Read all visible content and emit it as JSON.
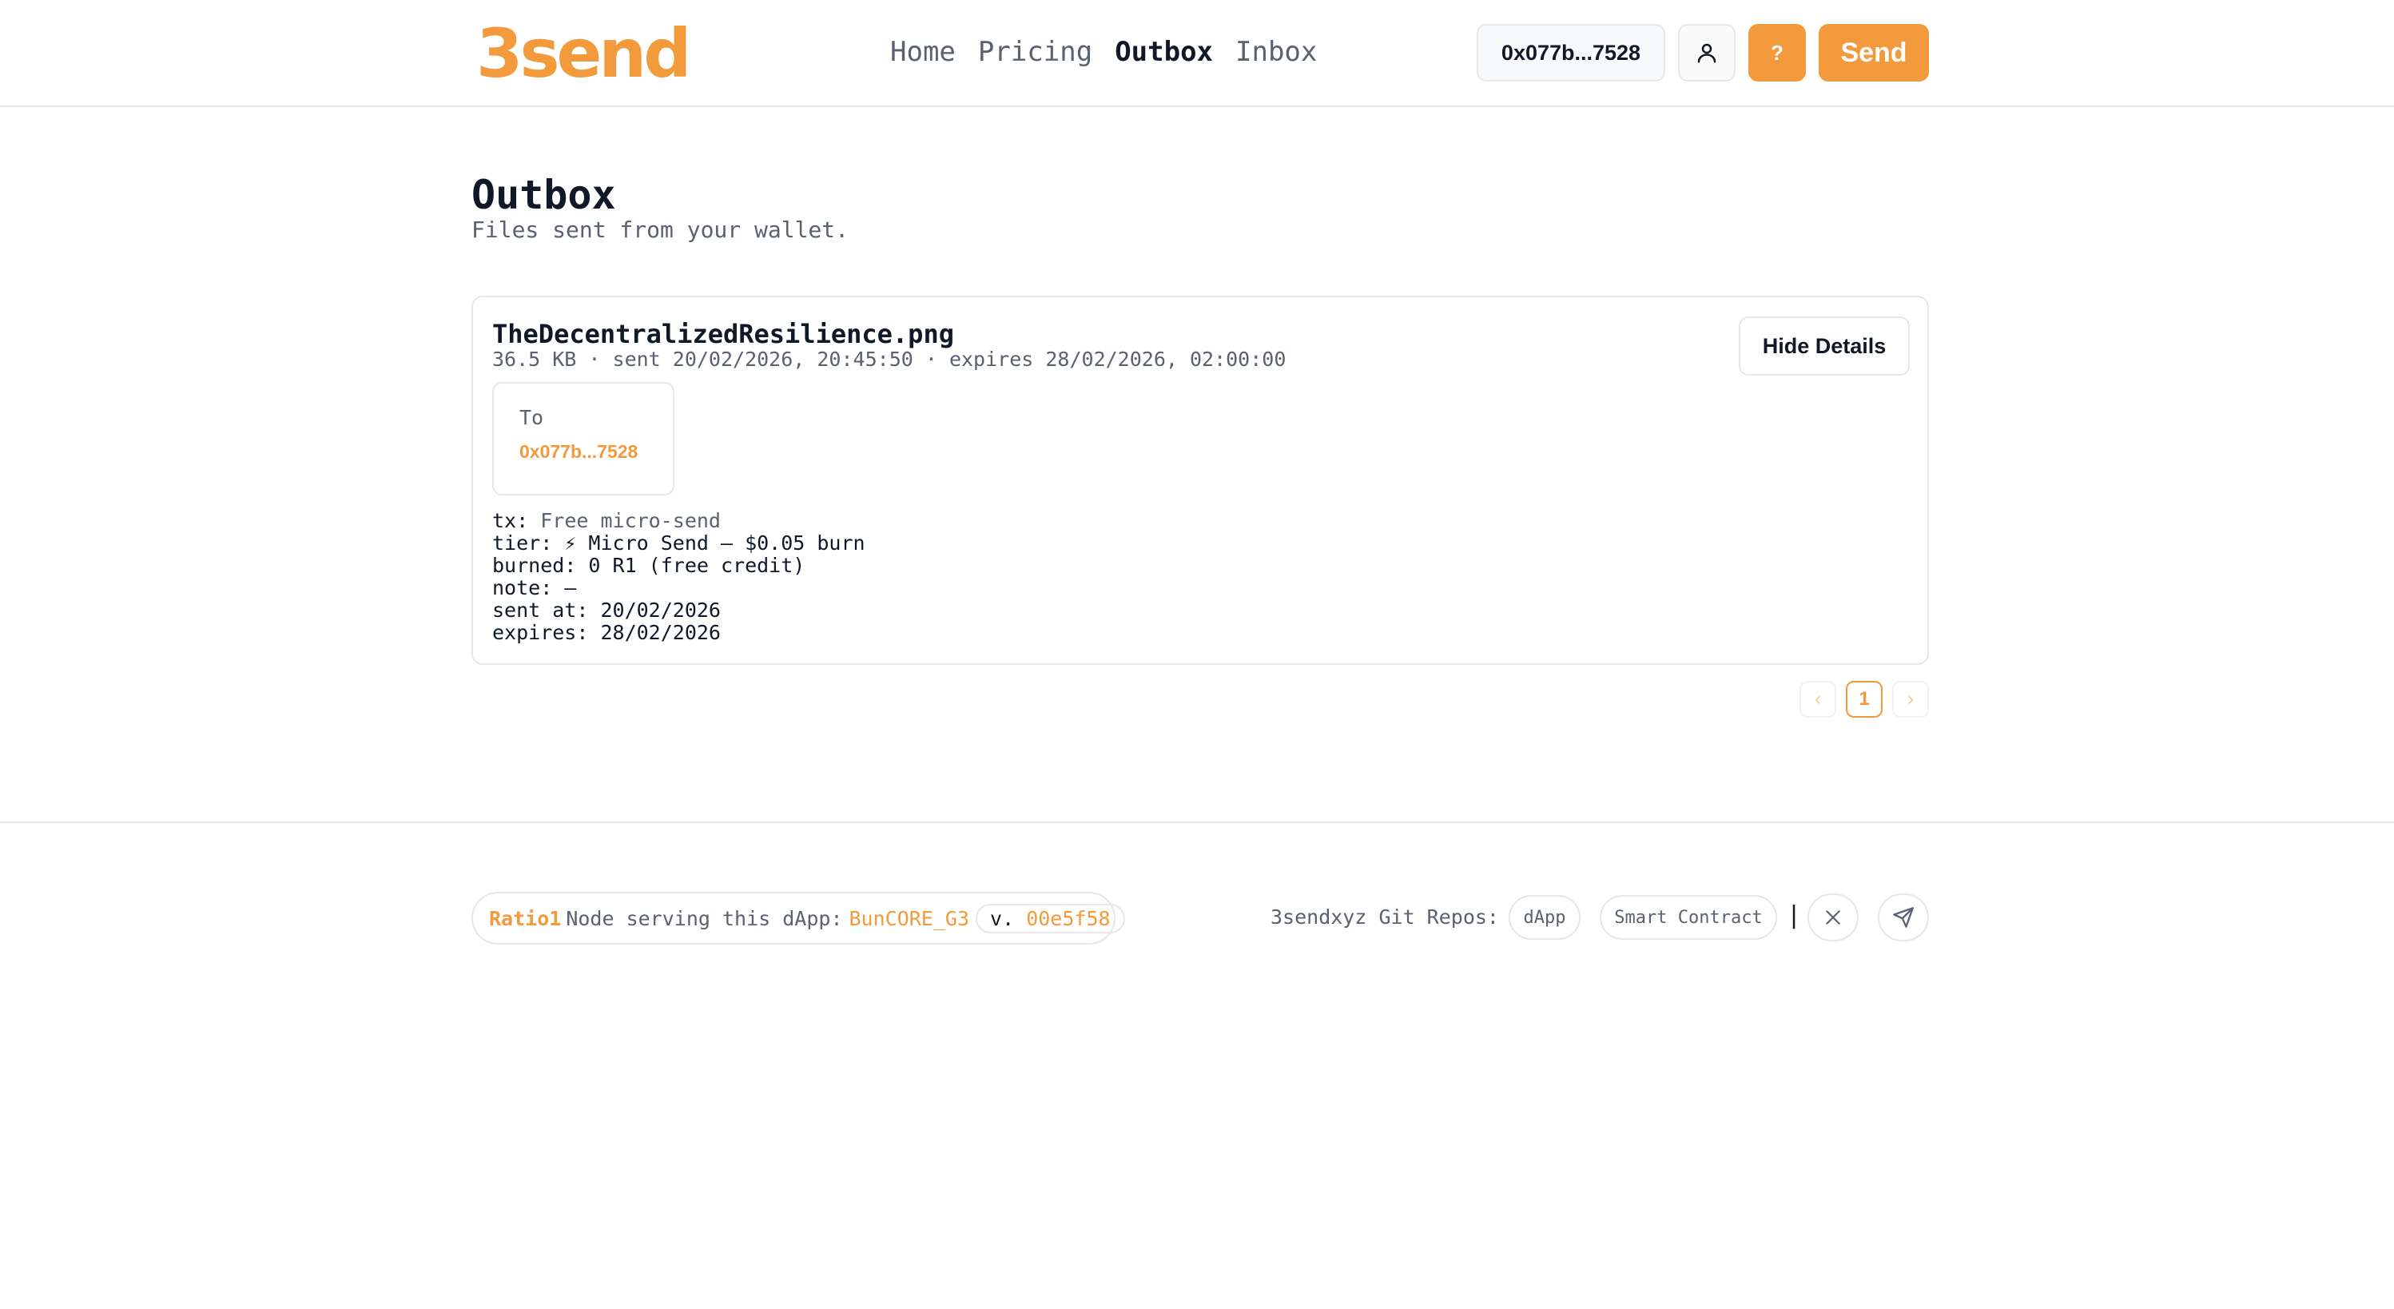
{
  "header": {
    "logo": "3send",
    "nav": [
      {
        "label": "Home"
      },
      {
        "label": "Pricing"
      },
      {
        "label": "Outbox",
        "active": true
      },
      {
        "label": "Inbox"
      }
    ],
    "wallet_label": "0x077b...7528",
    "help_label": "?",
    "send_label": "Send",
    "user_icon": "user-icon"
  },
  "page": {
    "title": "Outbox",
    "subtitle": "Files sent from your wallet."
  },
  "file": {
    "name": "TheDecentralizedResilience.png",
    "meta": "36.5 KB · sent 20/02/2026, 20:45:50 · expires 28/02/2026, 02:00:00",
    "hide_label": "Hide Details",
    "to_label": "To",
    "to_address": "0x077b...7528",
    "details": {
      "tx_key": "tx:",
      "tx_value": "Free micro-send",
      "tier": "tier: ⚡ Micro Send — $0.05 burn",
      "burned": "burned: 0 R1 (free credit)",
      "note": "note: —",
      "sent_at": "sent at: 20/02/2026",
      "expires": "expires: 28/02/2026"
    }
  },
  "pagination": {
    "prev": "‹",
    "current": "1",
    "next": "›"
  },
  "footer": {
    "brand": "Ratio1",
    "node_text": "Node serving this dApp:",
    "node_name": "BunCORE_G3",
    "version_prefix": "v.",
    "version": "00e5f58",
    "repos_label": "3sendxyz Git Repos:",
    "repo_dapp": "dApp",
    "repo_contract": "Smart Contract",
    "separator": "|",
    "x_icon": "x-close-icon",
    "telegram_icon": "send-plane-icon"
  },
  "colors": {
    "accent": "#f29a3c",
    "muted": "#5b6170",
    "border": "#e5e7eb"
  }
}
